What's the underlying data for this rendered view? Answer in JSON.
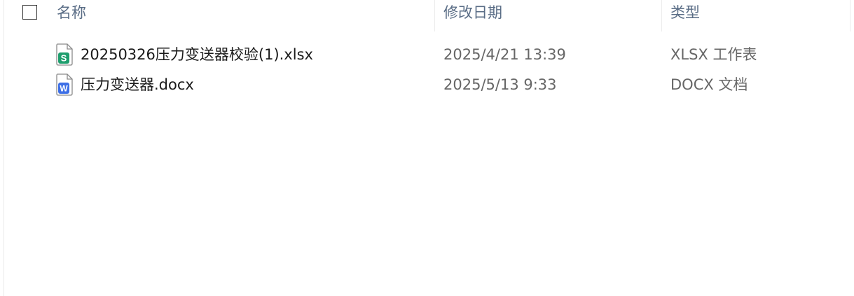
{
  "columns": {
    "name": "名称",
    "modified": "修改日期",
    "type": "类型"
  },
  "files": [
    {
      "icon": "xlsx-file-icon",
      "icon_letter": "S",
      "icon_color": "#1f9e6e",
      "name": "20250326压力变送器校验(1).xlsx",
      "modified": "2025/4/21 13:39",
      "type": "XLSX 工作表"
    },
    {
      "icon": "docx-file-icon",
      "icon_letter": "W",
      "icon_color": "#3d6fe6",
      "name": "压力变送器.docx",
      "modified": "2025/5/13 9:33",
      "type": "DOCX 文档"
    }
  ]
}
